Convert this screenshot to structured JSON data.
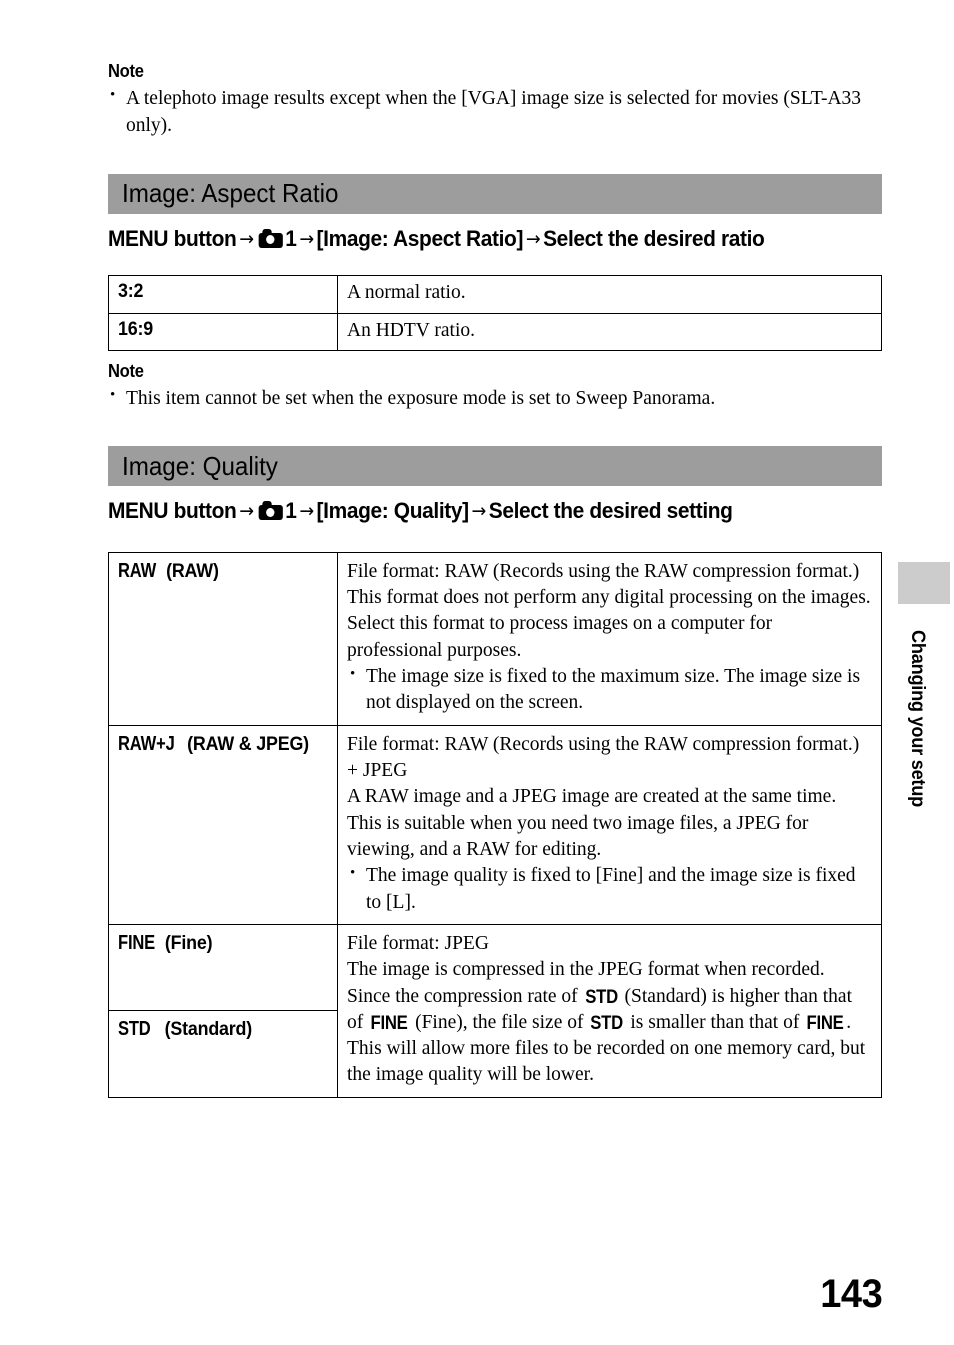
{
  "page": {
    "number": "143",
    "side_tab_label": "Changing your setup"
  },
  "note_top": {
    "label": "Note",
    "items": [
      "A telephoto image results except when the [VGA] image size is selected for movies (SLT-A33 only)."
    ]
  },
  "aspect_ratio": {
    "section_title": "Image: Aspect Ratio",
    "menu_path": {
      "prefix": "MENU button",
      "arrow": "→",
      "camera_icon": "camera-icon",
      "tab_number": "1",
      "item": "[Image: Aspect Ratio]",
      "action": "Select the desired ratio"
    },
    "rows": [
      {
        "key": "3:2",
        "value": "A normal ratio."
      },
      {
        "key": "16:9",
        "value": "An HDTV ratio."
      }
    ],
    "note": {
      "label": "Note",
      "items": [
        "This item cannot be set when the exposure mode is set to Sweep Panorama."
      ]
    }
  },
  "quality": {
    "section_title": "Image: Quality",
    "menu_path": {
      "prefix": "MENU button",
      "arrow": "→",
      "camera_icon": "camera-icon",
      "tab_number": "1",
      "item": "[Image: Quality]",
      "action": "Select the desired setting"
    },
    "rows": {
      "raw": {
        "glyph": "RAW",
        "key_suffix": "(RAW)",
        "paragraphs": [
          "File format: RAW (Records using the RAW compression format.)",
          "This format does not perform any digital processing on the images. Select this format to process images on a computer for professional purposes."
        ],
        "bullets": [
          "The image size is fixed to the maximum size. The image size is not displayed on the screen."
        ]
      },
      "raw_jpeg": {
        "glyph": "RAW+J",
        "key_suffix": "(RAW & JPEG)",
        "paragraphs": [
          "File format: RAW (Records using the RAW compression format.) + JPEG",
          "A RAW image and a JPEG image are created at the same time. This is suitable when you need two image files, a JPEG for viewing, and a RAW for editing."
        ],
        "bullets": [
          "The image quality is fixed to [Fine] and the image size is fixed to [L]."
        ]
      },
      "fine": {
        "glyph": "FINE",
        "key_suffix": "(Fine)"
      },
      "standard": {
        "glyph": "STD",
        "key_suffix": "(Standard)"
      },
      "jpeg_description": {
        "line1": "File format: JPEG",
        "part1": "The image is compressed in the JPEG format when recorded. Since the compression rate of ",
        "glyph_std_1": "STD",
        "part2": " (Standard) is higher than that of ",
        "glyph_fine_1": "FINE",
        "part3": " (Fine), the file size of ",
        "glyph_std_2": "STD",
        "part4": " is smaller than that of ",
        "glyph_fine_2": "FINE",
        "part5": ". This will allow more files to be recorded on one memory card, but the image quality will be lower."
      }
    }
  }
}
